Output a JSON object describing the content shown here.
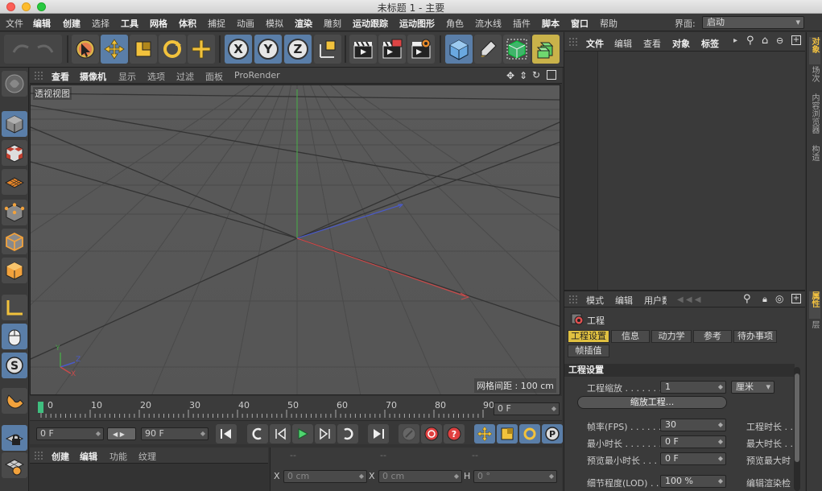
{
  "window": {
    "title": "未标题 1 - 主要"
  },
  "menu": {
    "items": [
      {
        "label": "文件",
        "bold": false
      },
      {
        "label": "编辑",
        "bold": true
      },
      {
        "label": "创建",
        "bold": true
      },
      {
        "label": "选择",
        "bold": false
      },
      {
        "label": "工具",
        "bold": true
      },
      {
        "label": "网格",
        "bold": true
      },
      {
        "label": "体积",
        "bold": true
      },
      {
        "label": "捕捉",
        "bold": false
      },
      {
        "label": "动画",
        "bold": false
      },
      {
        "label": "模拟",
        "bold": false
      },
      {
        "label": "渲染",
        "bold": true
      },
      {
        "label": "雕刻",
        "bold": false
      },
      {
        "label": "运动跟踪",
        "bold": true
      },
      {
        "label": "运动图形",
        "bold": true
      },
      {
        "label": "角色",
        "bold": false
      },
      {
        "label": "流水线",
        "bold": false
      },
      {
        "label": "插件",
        "bold": false
      },
      {
        "label": "脚本",
        "bold": true
      },
      {
        "label": "窗口",
        "bold": true
      },
      {
        "label": "帮助",
        "bold": false
      }
    ],
    "layout_label": "界面:",
    "layout_value": "启动"
  },
  "toolbar": {
    "x_label": "X",
    "y_label": "Y",
    "z_label": "Z"
  },
  "viewport": {
    "menu": [
      {
        "label": "查看",
        "bold": true
      },
      {
        "label": "摄像机",
        "bold": true
      },
      {
        "label": "显示",
        "bold": false
      },
      {
        "label": "选项",
        "bold": false
      },
      {
        "label": "过滤",
        "bold": false
      },
      {
        "label": "面板",
        "bold": false
      },
      {
        "label": "ProRender",
        "bold": false
      }
    ],
    "view_name": "透视视图",
    "grid_spacing": "网格间距 : 100 cm",
    "axis_x": "X",
    "axis_y": "Y",
    "axis_z": "Z"
  },
  "timeline": {
    "ticks": [
      "0",
      "10",
      "20",
      "30",
      "40",
      "50",
      "60",
      "70",
      "80",
      "90"
    ],
    "current_frame": "0 F"
  },
  "transport": {
    "start_frame": "0 F",
    "end_frame": "90 F",
    "record_label": "P"
  },
  "material_panel": {
    "menu": [
      {
        "label": "创建",
        "bold": true
      },
      {
        "label": "编辑",
        "bold": true
      },
      {
        "label": "功能",
        "bold": false
      },
      {
        "label": "纹理",
        "bold": false
      }
    ]
  },
  "coord_panel": {
    "header": [
      "--",
      "--",
      "--"
    ],
    "rows": [
      {
        "a": "X",
        "av": "0 cm",
        "b": "X",
        "bv": "0 cm",
        "c": "H",
        "cv": "0 °"
      }
    ]
  },
  "object_manager": {
    "menu": [
      {
        "label": "文件",
        "bold": true
      },
      {
        "label": "编辑",
        "bold": false
      },
      {
        "label": "查看",
        "bold": false
      },
      {
        "label": "对象",
        "bold": true
      },
      {
        "label": "标签",
        "bold": true
      }
    ]
  },
  "right_tabs": [
    {
      "label": "对象",
      "active": true
    },
    {
      "label": "场次",
      "active": false
    },
    {
      "label": "内容浏览器",
      "active": false
    },
    {
      "label": "构造",
      "active": false
    },
    {
      "label": "属性",
      "active": true
    },
    {
      "label": "层",
      "active": false
    }
  ],
  "attribute_manager": {
    "menu": [
      "模式",
      "编辑",
      "用户数"
    ],
    "object_title": "工程",
    "tabs": [
      {
        "label": "工程设置",
        "active": true
      },
      {
        "label": "信息",
        "active": false
      },
      {
        "label": "动力学",
        "active": false
      },
      {
        "label": "参考",
        "active": false
      },
      {
        "label": "待办事项",
        "active": false
      },
      {
        "label": "帧插值",
        "active": false
      }
    ],
    "section": "工程设置",
    "project_scale_label": "工程缩放 . . . . . . .",
    "project_scale_value": "1",
    "project_scale_unit": "厘米",
    "scale_button": "缩放工程...",
    "fps_label": "帧率(FPS) . . . . . .",
    "fps_value": "30",
    "project_length_label": "工程时长 . .",
    "min_time_label": "最小时长 . . . . . . .",
    "min_time_value": "0 F",
    "max_time_label": "最大时长 . .",
    "preview_min_label": "预览最小时长 . . . .",
    "preview_min_value": "0 F",
    "preview_max_label": "预览最大时",
    "lod_label": "细节程度(LOD) . . . .",
    "lod_value": "100 %",
    "render_lod_label": "编辑渲染检"
  },
  "colors": {
    "accent_yellow": "#e0c040",
    "accent_blue": "#5a7ea8",
    "axis_red": "#c84040",
    "axis_green": "#40a040",
    "axis_blue": "#4050c8"
  }
}
